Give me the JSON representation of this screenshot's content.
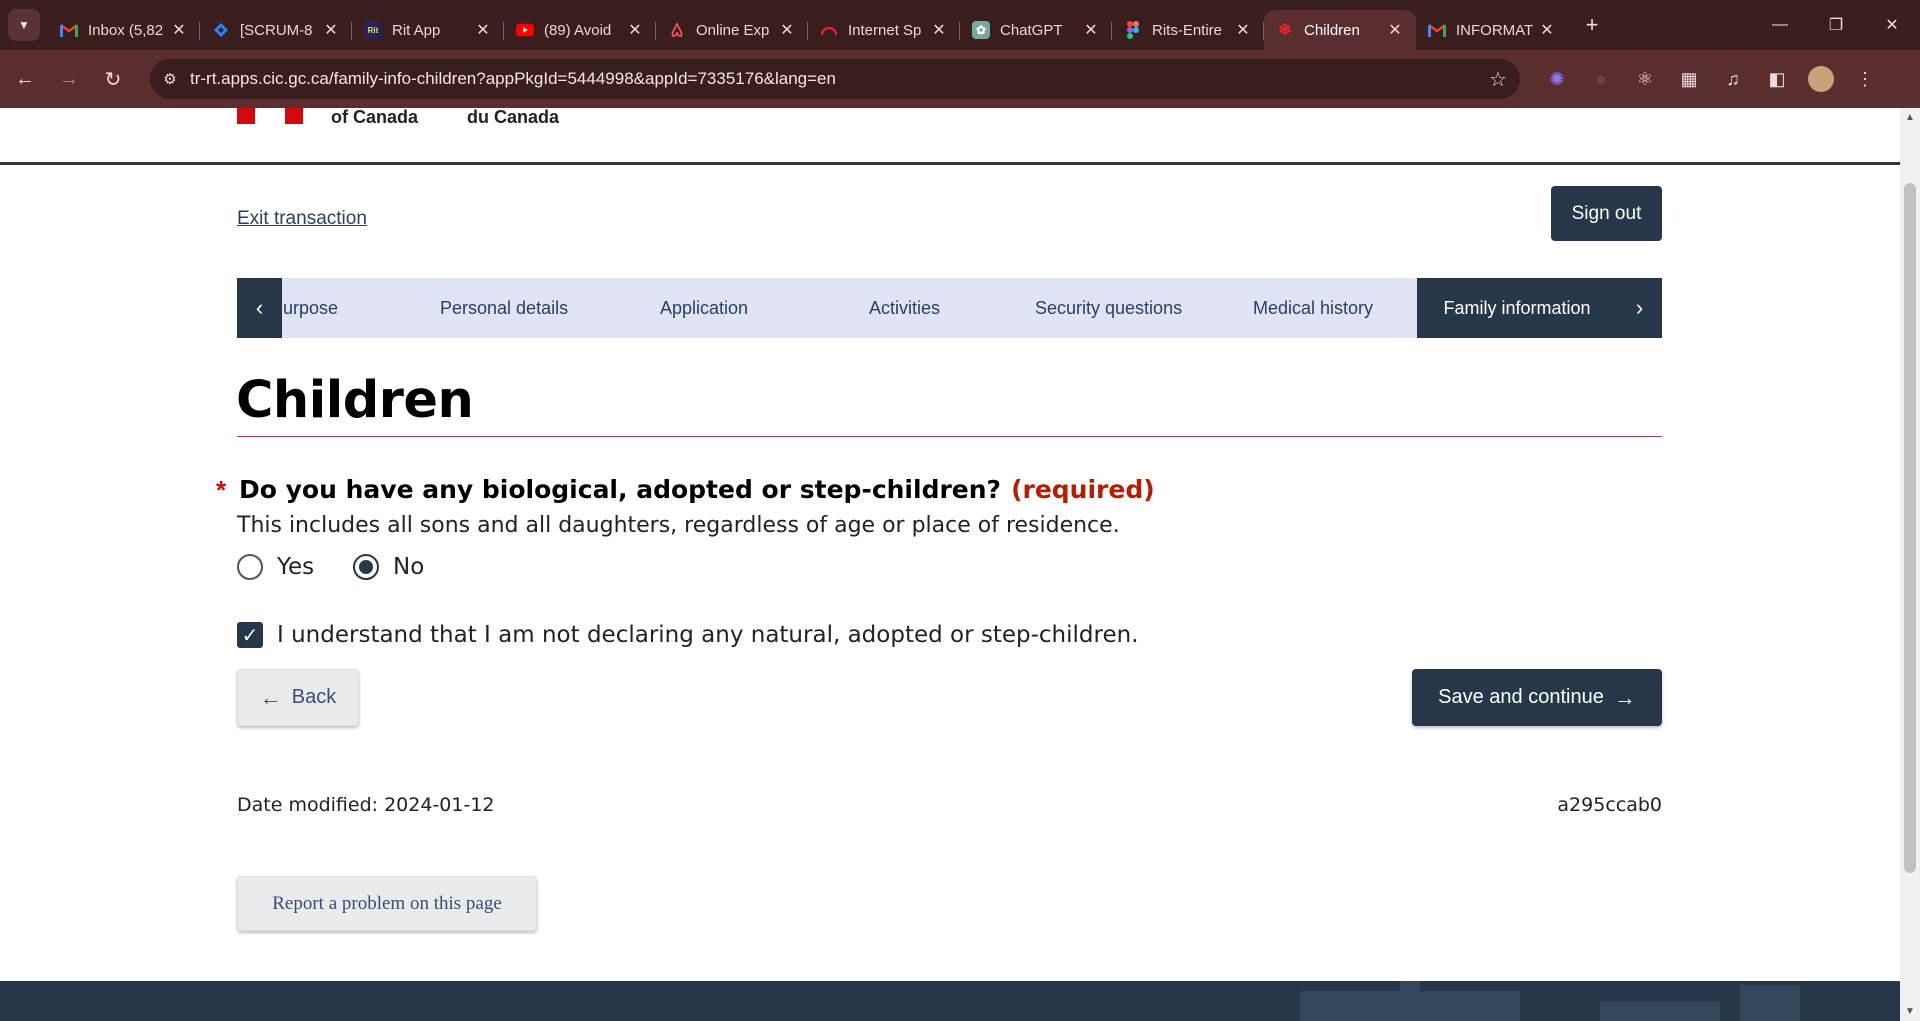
{
  "browser": {
    "tabs": [
      {
        "title": "Inbox (5,82",
        "icon": "gmail-icon"
      },
      {
        "title": "[SCRUM-8",
        "icon": "jira-icon"
      },
      {
        "title": "Rit App",
        "icon": "rit-icon"
      },
      {
        "title": "(89) Avoid",
        "icon": "youtube-icon"
      },
      {
        "title": "Online Exp",
        "icon": "airbnb-icon"
      },
      {
        "title": "Internet Sp",
        "icon": "speedtest-icon"
      },
      {
        "title": "ChatGPT",
        "icon": "chatgpt-icon"
      },
      {
        "title": "Rits-Entire",
        "icon": "figma-icon"
      },
      {
        "title": "Children",
        "icon": "maple-leaf-icon",
        "active": true
      },
      {
        "title": "INFORMAT",
        "icon": "gmail-icon"
      }
    ],
    "url": "tr-rt.apps.cic.gc.ca/family-info-children?appPkgId=5444998&appId=7335176&lang=en"
  },
  "header": {
    "gov_en": "of Canada",
    "gov_fr": "du Canada",
    "exit_link": "Exit transaction",
    "sign_out": "Sign out"
  },
  "steps": {
    "items": [
      "urpose",
      "Personal details",
      "Application",
      "Activities",
      "Security questions",
      "Medical history",
      "Family information"
    ],
    "active": "Family information"
  },
  "main": {
    "title": "Children",
    "required_marker": "*",
    "question": "Do you have any biological, adopted or step-children?",
    "required_label": "(required)",
    "hint": "This includes all sons and all daughters, regardless of age or place of residence.",
    "options": [
      {
        "label": "Yes",
        "selected": false
      },
      {
        "label": "No",
        "selected": true
      }
    ],
    "confirm_label": "I understand that I am not declaring any natural, adopted or step-children.",
    "confirm_checked": true,
    "back_label": "Back",
    "save_label": "Save and continue"
  },
  "footer": {
    "date_modified": "Date modified: 2024-01-12",
    "version": "a295ccab0",
    "report_label": "Report a problem on this page"
  },
  "colors": {
    "primary": "#26374a",
    "link": "#284162",
    "required": "#b81c00",
    "step_bg": "#e1e4f4",
    "rule": "#af3c43"
  }
}
